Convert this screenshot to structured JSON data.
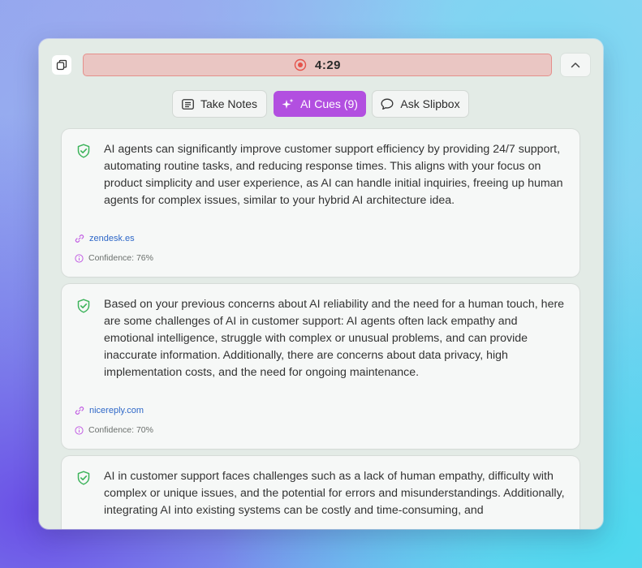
{
  "timer": {
    "time": "4:29"
  },
  "tabs": [
    {
      "label": "Take Notes",
      "icon": "notes-icon",
      "active": false
    },
    {
      "label": "AI Cues (9)",
      "icon": "sparkle-icon",
      "active": true
    },
    {
      "label": "Ask Slipbox",
      "icon": "chat-bubble-icon",
      "active": false
    }
  ],
  "cues": [
    {
      "text": "AI agents can significantly improve customer support efficiency by providing 24/7 support, automating routine tasks, and reducing response times. This aligns with your focus on product simplicity and user experience, as AI can handle initial inquiries, freeing up human agents for complex issues, similar to your hybrid AI architecture idea.",
      "source": "zendesk.es",
      "confidence": "Confidence: 76%"
    },
    {
      "text": "Based on your previous concerns about AI reliability and the need for a human touch, here are some challenges of AI in customer support: AI agents often lack empathy and emotional intelligence, struggle with complex or unusual problems, and can provide inaccurate information. Additionally, there are concerns about data privacy, high implementation costs, and the need for ongoing maintenance.",
      "source": "nicereply.com",
      "confidence": "Confidence: 70%"
    },
    {
      "text": "AI in customer support faces challenges such as a lack of human empathy, difficulty with complex or unique issues, and the potential for errors and misunderstandings. Additionally, integrating AI into existing systems can be costly and time-consuming, and"
    }
  ],
  "colors": {
    "accent": "#b24fe0",
    "timer_bg": "#eac6c3",
    "timer_border": "#e58f8b",
    "record_dot": "#e5534b",
    "shield": "#3cb35a",
    "link": "#2f68c8"
  }
}
